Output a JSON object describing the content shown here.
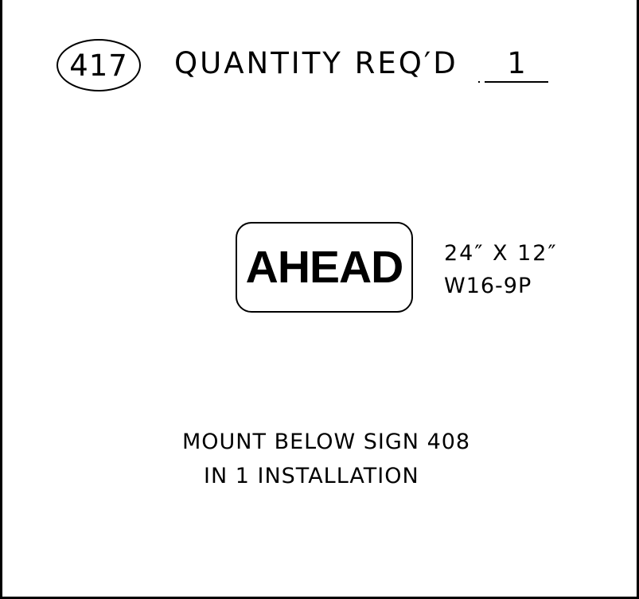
{
  "header": {
    "sign_number": "417",
    "quantity_label": "QUANTITY REQ′D",
    "quantity_value": "1"
  },
  "sign": {
    "legend": "AHEAD",
    "size": "24″ X 12″",
    "code": "W16-9P"
  },
  "notes": {
    "line_1": "MOUNT BELOW SIGN 408",
    "line_2": "IN 1 INSTALLATION"
  }
}
